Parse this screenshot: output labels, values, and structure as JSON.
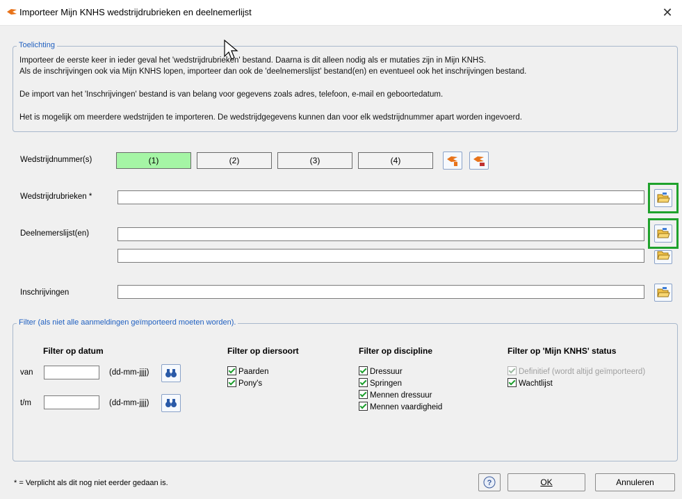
{
  "window": {
    "title": "Importeer Mijn KNHS wedstrijdrubrieken en deelnemerlijst",
    "close_label": "✕"
  },
  "explanation": {
    "legend": "Toelichting",
    "line1": "Importeer de eerste keer in ieder geval het 'wedstrijdrubrieken' bestand. Daarna is dit alleen nodig als er mutaties zijn in Mijn KNHS.",
    "line2": "Als de inschrijvingen ook via Mijn KNHS lopen, importeer dan ook de 'deelnemerslijst' bestand(en) en eventueel ook het inschrijvingen bestand.",
    "line3": "De import van het 'Inschrijvingen' bestand is van belang voor gegevens zoals adres, telefoon, e-mail en geboortedatum.",
    "line4": "Het is mogelijk om meerdere wedstrijden te importeren. De wedstrijdgegevens kunnen dan voor elk wedstrijdnummer apart worden ingevoerd."
  },
  "competition": {
    "label": "Wedstrijdnummer(s)",
    "buttons": [
      "(1)",
      "(2)",
      "(3)",
      "(4)"
    ],
    "active_index": 0,
    "active_color": "#a5f5a5"
  },
  "fields": {
    "rubrieken_label": "Wedstrijdrubrieken *",
    "deelnemers_label": "Deelnemerslijst(en)",
    "inschrijvingen_label": "Inschrijvingen",
    "rubrieken_value": "",
    "deelnemers_value_1": "",
    "deelnemers_value_2": "",
    "inschrijvingen_value": ""
  },
  "filter": {
    "legend": "Filter (als niet alle aanmeldingen geïmporteerd moeten worden).",
    "date": {
      "heading": "Filter op datum",
      "from_label": "van",
      "to_label": "t/m",
      "format_hint_from": "(dd-mm-jjjj)",
      "format_hint_to": "(dd-mm-jjjj)",
      "from_value": "",
      "to_value": ""
    },
    "animal": {
      "heading": "Filter op diersoort",
      "options": [
        "Paarden",
        "Pony's"
      ]
    },
    "discipline": {
      "heading": "Filter op discipline",
      "options": [
        "Dressuur",
        "Springen",
        "Mennen dressuur",
        "Mennen vaardigheid"
      ]
    },
    "status": {
      "heading": "Filter op 'Mijn KNHS' status",
      "options": [
        "Definitief (wordt altijd geïmporteerd)",
        "Wachtlijst"
      ]
    }
  },
  "footer": {
    "note": "* = Verplicht als dit nog niet eerder gedaan is.",
    "ok_label": "OK",
    "cancel_label": "Annuleren"
  },
  "colors": {
    "highlight": "#1fa22c",
    "legend_text": "#2060c0"
  }
}
